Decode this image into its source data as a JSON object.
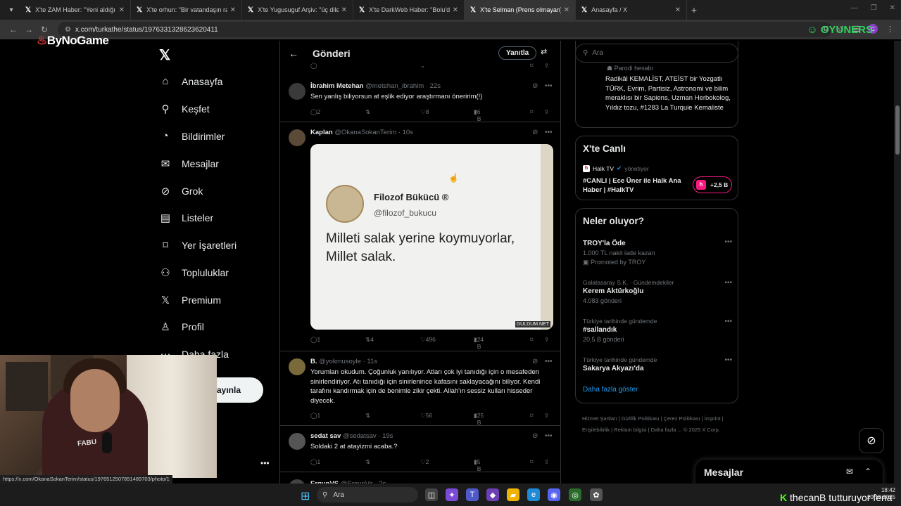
{
  "browser": {
    "tabs": [
      {
        "title": "X'te ZAM Haber: \"Yeni aldığı ev",
        "active": false
      },
      {
        "title": "X'te orhun: \"Bir vatandaşın racı",
        "active": false
      },
      {
        "title": "X'te Yugusuguf Arşiv: \"üç dilek",
        "active": false
      },
      {
        "title": "X'te DarkWeb Haber: \"Bolu'da",
        "active": false
      },
      {
        "title": "X'te Selman (Prens olmayan): \"",
        "active": true
      },
      {
        "title": "Anasayfa / X",
        "active": false
      }
    ],
    "url": "x.com/turkathe/status/1976331328623620411",
    "status_url": "https://x.com/OkanaSokanTerim/status/1976512507851489703/photo/1"
  },
  "overlays": {
    "left_logo": "ByNoGame",
    "right_logo": "OYUNERS",
    "ticker_prefix": "K",
    "ticker_text": "thecanB tutturuyor fena"
  },
  "nav": {
    "items": [
      {
        "icon": "home-icon",
        "label": "Anasayfa"
      },
      {
        "icon": "explore-icon",
        "label": "Keşfet"
      },
      {
        "icon": "bell-icon",
        "label": "Bildirimler"
      },
      {
        "icon": "mail-icon",
        "label": "Mesajlar"
      },
      {
        "icon": "grok-icon",
        "label": "Grok"
      },
      {
        "icon": "list-icon",
        "label": "Listeler"
      },
      {
        "icon": "bookmark-icon",
        "label": "Yer İşaretleri"
      },
      {
        "icon": "communities-icon",
        "label": "Topluluklar"
      },
      {
        "icon": "x-icon",
        "label": "Premium"
      },
      {
        "icon": "profile-icon",
        "label": "Profil"
      },
      {
        "icon": "more-icon",
        "label": "Daha fazla"
      }
    ],
    "post_button": "ayınla"
  },
  "main": {
    "title": "Gönderi",
    "reply_button": "Yanıtla",
    "tweets": [
      {
        "name": "İbrahim Metehan",
        "handle": "@metehan_ibrahim",
        "time": "22s",
        "text": "Sen yanlış biliyorsun at eşlik ediyor  araştırmanı öneririm(!)",
        "replies": "2",
        "retweets": "",
        "likes": "8",
        "views": "6 B"
      },
      {
        "name": "Kaplan",
        "handle": "@OkanaSokanTerim",
        "time": "10s",
        "text": "",
        "replies": "1",
        "retweets": "4",
        "likes": "496",
        "views": "24 B",
        "image": {
          "quote_name": "Filozof Bükücü ®",
          "quote_handle": "@filozof_bukucu",
          "quote_text": "Milleti salak yerine koymuyorlar, Millet salak.",
          "watermark": "GULDUM.NET"
        }
      },
      {
        "name": "B.",
        "handle": "@yokmusoyle",
        "time": "11s",
        "text": "Yorumları okudum. Çoğunluk yanılıyor. Atları çok iyi tanıdığı için o mesafeden sinirlendiriyor. Atı tanıdığı için sinirlenince kafasını saklayacağını biliyor. Kendi tarafını kandırmak için de benimle zikir çekti. Allah'ın sessiz kulları hisseder diyecek.",
        "replies": "1",
        "retweets": "",
        "likes": "56",
        "views": "25 B"
      },
      {
        "name": "sedat sav",
        "handle": "@sedatsav",
        "time": "19s",
        "text": "Soldaki 2 at atayizmi acaba.?",
        "replies": "1",
        "retweets": "",
        "likes": "2",
        "views": "5 B"
      },
      {
        "name": "ErgunVS",
        "handle": "@ErgunVs",
        "time": "2s",
        "text": "",
        "replies": "",
        "retweets": "",
        "likes": "",
        "views": ""
      }
    ]
  },
  "right": {
    "search_placeholder": "Ara",
    "parody_label": "Parodi hesabı",
    "bio": "Radikâl KEMALİST, ATEİST bir Yozgatlı TÜRK, Evrim, Partisiz, Astronomi ve bilim meraklısı bir Sapiens, Uzman Herbokolog, Yıldız tozu, #1283 La Turquie Kemaliste",
    "live": {
      "title": "X'te Canlı",
      "source": "Halk TV",
      "source_badge": "h",
      "manager": "yönetiyor",
      "show": "#CANLI | Ece Üner ile Halk Ana Haber | #HalkTV",
      "count": "+2,5 B"
    },
    "trends_title": "Neler oluyor?",
    "trends": [
      {
        "meta": "",
        "name": "TROY'la Öde",
        "sub": "1.000 TL nakit iade kazan",
        "promo": "Promoted by TROY"
      },
      {
        "meta": "Galatasaray S.K. · Gündemdekiler",
        "name": "Kerem Aktürkoğlu",
        "sub": "4.083 gönderi",
        "promo": ""
      },
      {
        "meta": "Türkiye tarihinde gündemde",
        "name": "#sallandık",
        "sub": "20,5 B gönderi",
        "promo": ""
      },
      {
        "meta": "Türkiye tarihinde gündemde",
        "name": "Sakarya Akyazı'da",
        "sub": "",
        "promo": ""
      }
    ],
    "show_more": "Daha fazla göster",
    "footer": "Hizmet Şartları  |  Gizlilik Politikası  |  Çerez Politikası  |  İmprint  |  Erişilebilirlik  |  Reklam bilgisi  |  Daha fazla ...  © 2025 X Corp.",
    "messages_drawer": "Mesajlar"
  },
  "webcam": {
    "shirt_text": "FABU"
  },
  "taskbar": {
    "search": "Ara",
    "time": "18:42",
    "date": "20.10.2025"
  }
}
